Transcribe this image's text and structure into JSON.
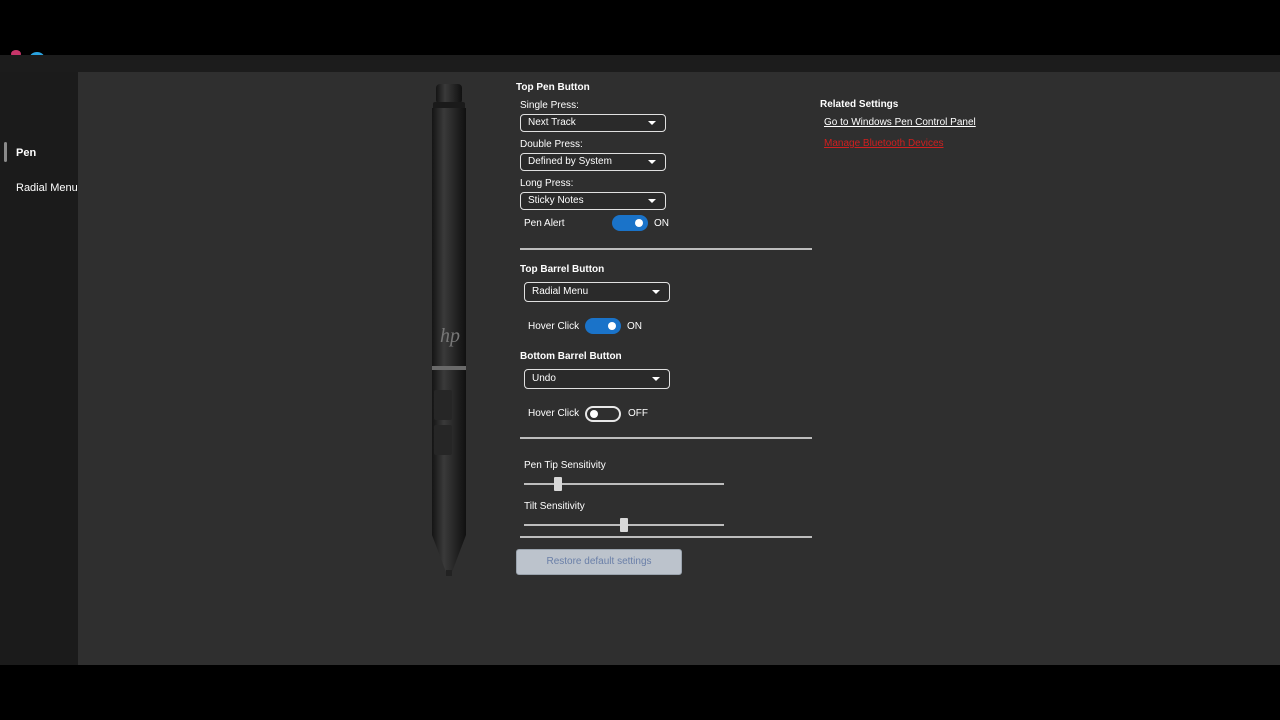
{
  "sidebar": {
    "items": [
      {
        "label": "Pen",
        "selected": true
      },
      {
        "label": "Radial Menu",
        "selected": false
      }
    ]
  },
  "top_pen_button": {
    "title": "Top Pen Button",
    "single_press_label": "Single Press:",
    "single_press_value": "Next Track",
    "double_press_label": "Double Press:",
    "double_press_value": "Defined by System",
    "long_press_label": "Long Press:",
    "long_press_value": "Sticky Notes",
    "pen_alert_label": "Pen Alert",
    "pen_alert_state": "ON"
  },
  "top_barrel_button": {
    "title": "Top Barrel Button",
    "value": "Radial Menu",
    "hover_click_label": "Hover Click",
    "hover_click_state": "ON"
  },
  "bottom_barrel_button": {
    "title": "Bottom Barrel Button",
    "value": "Undo",
    "hover_click_label": "Hover Click",
    "hover_click_state": "OFF"
  },
  "sensitivity": {
    "pen_tip_label": "Pen Tip Sensitivity",
    "pen_tip_value_fraction": 0.17,
    "tilt_label": "Tilt Sensitivity",
    "tilt_value_fraction": 0.5
  },
  "restore_label": "Restore default settings",
  "related": {
    "title": "Related Settings",
    "pen_control_link": "Go to Windows Pen Control Panel",
    "bluetooth_link": "Manage Bluetooth Devices"
  },
  "colors": {
    "toggle_on": "#1a73c9",
    "link_red": "#d01f1f",
    "content_bg": "#2f2f2f"
  }
}
